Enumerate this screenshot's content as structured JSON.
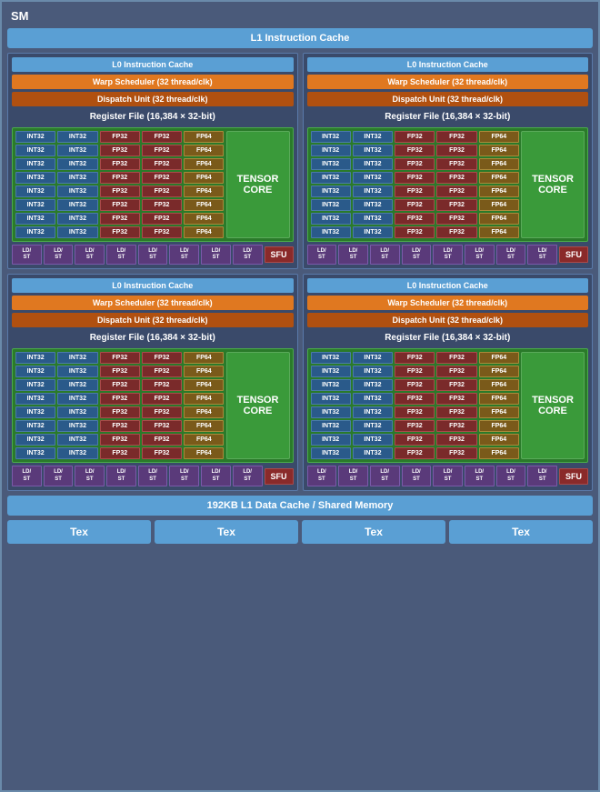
{
  "sm": {
    "title": "SM",
    "l1_instruction_cache": "L1 Instruction Cache",
    "l1_data_cache": "192KB L1 Data Cache / Shared Memory",
    "units": [
      {
        "l0_cache": "L0 Instruction Cache",
        "warp_scheduler": "Warp Scheduler (32 thread/clk)",
        "dispatch_unit": "Dispatch Unit (32 thread/clk)",
        "register_file": "Register File (16,384 × 32-bit)",
        "tensor_core": "TENSOR CORE",
        "sfu": "SFU"
      },
      {
        "l0_cache": "L0 Instruction Cache",
        "warp_scheduler": "Warp Scheduler (32 thread/clk)",
        "dispatch_unit": "Dispatch Unit (32 thread/clk)",
        "register_file": "Register File (16,384 × 32-bit)",
        "tensor_core": "TENSOR CORE",
        "sfu": "SFU"
      },
      {
        "l0_cache": "L0 Instruction Cache",
        "warp_scheduler": "Warp Scheduler (32 thread/clk)",
        "dispatch_unit": "Dispatch Unit (32 thread/clk)",
        "register_file": "Register File (16,384 × 32-bit)",
        "tensor_core": "TENSOR CORE",
        "sfu": "SFU"
      },
      {
        "l0_cache": "L0 Instruction Cache",
        "warp_scheduler": "Warp Scheduler (32 thread/clk)",
        "dispatch_unit": "Dispatch Unit (32 thread/clk)",
        "register_file": "Register File (16,384 × 32-bit)",
        "tensor_core": "TENSOR CORE",
        "sfu": "SFU"
      }
    ],
    "tex_units": [
      "Tex",
      "Tex",
      "Tex",
      "Tex"
    ],
    "core_rows": [
      [
        "INT32",
        "INT32",
        "FP32",
        "FP32",
        "FP64"
      ],
      [
        "INT32",
        "INT32",
        "FP32",
        "FP32",
        "FP64"
      ],
      [
        "INT32",
        "INT32",
        "FP32",
        "FP32",
        "FP64"
      ],
      [
        "INT32",
        "INT32",
        "FP32",
        "FP32",
        "FP64"
      ],
      [
        "INT32",
        "INT32",
        "FP32",
        "FP32",
        "FP64"
      ],
      [
        "INT32",
        "INT32",
        "FP32",
        "FP32",
        "FP64"
      ],
      [
        "INT32",
        "INT32",
        "FP32",
        "FP32",
        "FP64"
      ],
      [
        "INT32",
        "INT32",
        "FP32",
        "FP32",
        "FP64"
      ]
    ],
    "ld_st_count": 8
  }
}
